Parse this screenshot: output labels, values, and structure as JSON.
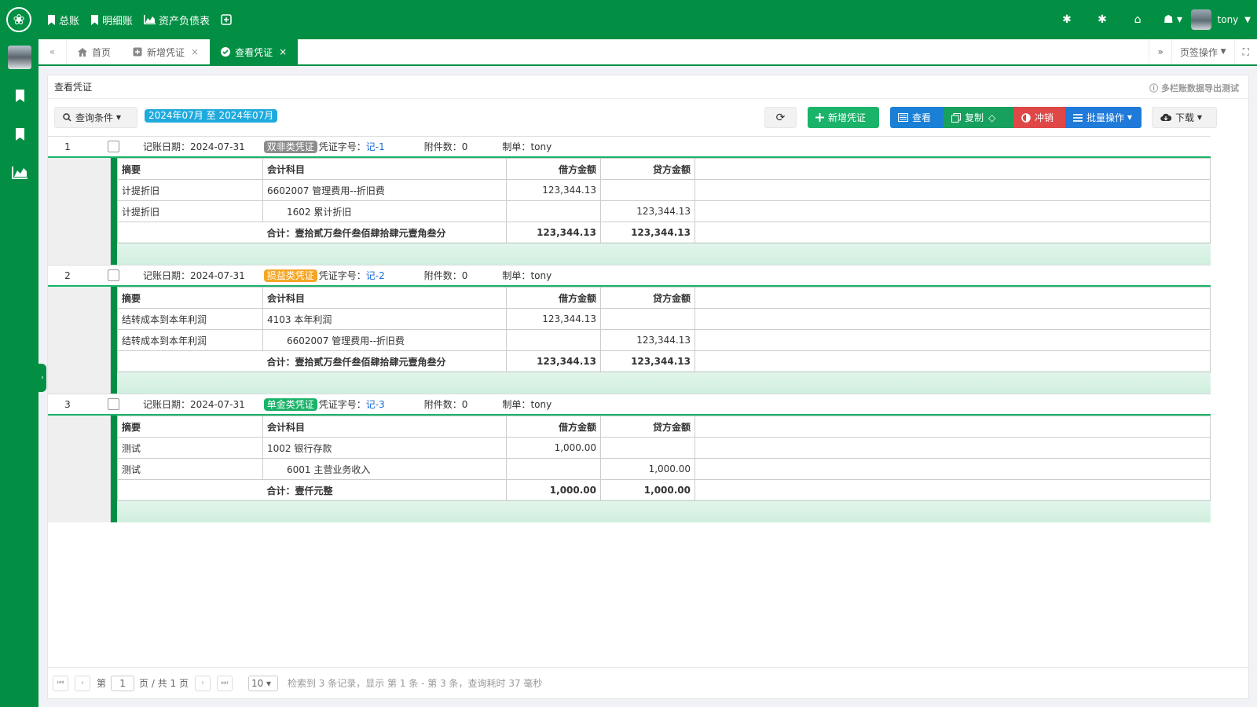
{
  "topnav": {
    "items": [
      {
        "label": "总账"
      },
      {
        "label": "明细账"
      },
      {
        "label": "资产负债表"
      }
    ]
  },
  "user": {
    "name": "tony"
  },
  "tabs": [
    {
      "label": "首页"
    },
    {
      "label": "新增凭证"
    },
    {
      "label": "查看凭证"
    }
  ],
  "tab_ops_label": "页签操作",
  "panel": {
    "title": "查看凭证",
    "note": "多栏账数据导出测试"
  },
  "toolbar": {
    "query_label": "查询条件",
    "date_range": "2024年07月 至 2024年07月",
    "new_label": "新增凭证",
    "view_label": "查看",
    "copy_label": "复制",
    "reverse_label": "冲销",
    "batch_label": "批量操作",
    "download_label": "下载"
  },
  "labels": {
    "date": "记账日期：",
    "voucher_no": "凭证字号：",
    "attach": "附件数：",
    "maker": "制单：",
    "col_summary": "摘要",
    "col_account": "会计科目",
    "col_debit": "借方金额",
    "col_credit": "贷方金额",
    "total_prefix": "合计："
  },
  "colors": {
    "brand": "#028f43",
    "badge_gray": "#8c8c8c",
    "badge_orange": "#f5a623",
    "badge_green": "#1ab369"
  },
  "vouchers": [
    {
      "index": "1",
      "date": "2024-07-31",
      "badge": "双非类凭证",
      "voucher_no": "记-1",
      "attach": "0",
      "maker": "tony",
      "entries": [
        {
          "summary": "计提折旧",
          "account": "6602007 管理费用--折旧费",
          "debit": "123,344.13",
          "credit": ""
        },
        {
          "summary": "计提折旧",
          "account": "1602 累计折旧",
          "debit": "",
          "credit": "123,344.13"
        }
      ],
      "total_text": "壹拾贰万叁仟叁佰肆拾肆元壹角叁分",
      "total_debit": "123,344.13",
      "total_credit": "123,344.13"
    },
    {
      "index": "2",
      "date": "2024-07-31",
      "badge": "损益类凭证",
      "voucher_no": "记-2",
      "attach": "0",
      "maker": "tony",
      "entries": [
        {
          "summary": "结转成本到本年利润",
          "account": "4103 本年利润",
          "debit": "123,344.13",
          "credit": ""
        },
        {
          "summary": "结转成本到本年利润",
          "account": "6602007 管理费用--折旧费",
          "debit": "",
          "credit": "123,344.13"
        }
      ],
      "total_text": "壹拾贰万叁仟叁佰肆拾肆元壹角叁分",
      "total_debit": "123,344.13",
      "total_credit": "123,344.13"
    },
    {
      "index": "3",
      "date": "2024-07-31",
      "badge": "单金类凭证",
      "voucher_no": "记-3",
      "attach": "0",
      "maker": "tony",
      "entries": [
        {
          "summary": "测试",
          "account": "1002 银行存款",
          "debit": "1,000.00",
          "credit": ""
        },
        {
          "summary": "测试",
          "account": "6001 主营业务收入",
          "debit": "",
          "credit": "1,000.00"
        }
      ],
      "total_text": "壹仟元整",
      "total_debit": "1,000.00",
      "total_credit": "1,000.00"
    }
  ],
  "pager": {
    "page_prefix": "第",
    "page": "1",
    "page_suffix": "页 / 共 1 页",
    "page_size": "10",
    "summary": "检索到 3 条记录，显示 第 1 条 - 第 3 条，查询耗时 37 毫秒"
  }
}
